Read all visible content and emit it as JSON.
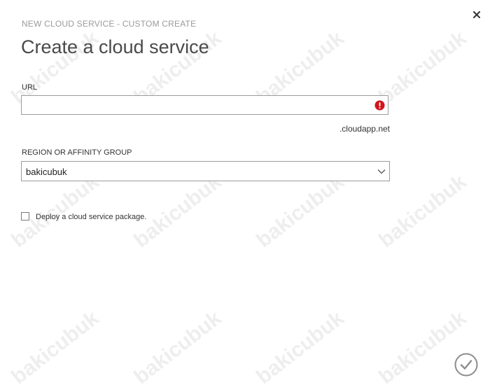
{
  "dialog": {
    "breadcrumb": "NEW CLOUD SERVICE - CUSTOM CREATE",
    "title": "Create a cloud service",
    "close_icon": "close-icon"
  },
  "url_field": {
    "label": "URL",
    "value": "",
    "suffix": ".cloudapp.net",
    "status_icon": "error-icon"
  },
  "region_field": {
    "label": "REGION OR AFFINITY GROUP",
    "selected": "bakicubuk",
    "dropdown_icon": "chevron-down-icon"
  },
  "deploy_package": {
    "label": "Deploy a cloud service package.",
    "checked": false
  },
  "submit": {
    "icon": "checkmark-icon"
  },
  "watermark": {
    "text": "bakicubuk"
  },
  "colors": {
    "error": "#d1141a",
    "border": "#9b9b9b",
    "title": "#4a4a4a",
    "breadcrumb": "#9a9a9a"
  }
}
